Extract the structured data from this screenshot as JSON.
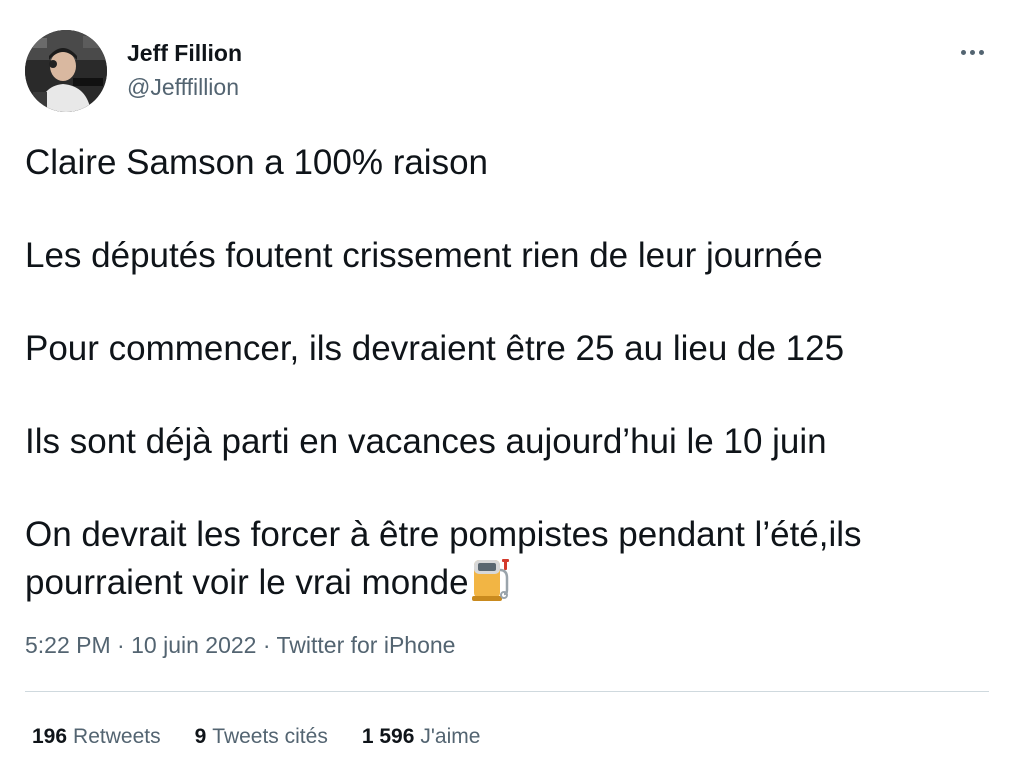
{
  "author": {
    "display_name": "Jeff Fillion",
    "handle": "@Jefffillion",
    "avatar_icon": "profile-photo"
  },
  "more_icon": "more-horizontal-icon",
  "tweet": {
    "paragraphs": [
      "Claire Samson a 100% raison",
      "Les députés foutent crissement rien de leur journée",
      "Pour commencer, ils devraient être 25 au lieu de 125",
      "Ils sont déjà parti en vacances aujourd’hui le 10 juin",
      "On devrait les forcer à être pompistes pendant l’été,ils pourraient voir le vrai monde"
    ],
    "emoji": "fuel-pump"
  },
  "meta": {
    "time": "5:22 PM",
    "separator": "·",
    "date": "10 juin 2022",
    "source": "Twitter for iPhone"
  },
  "stats": {
    "retweets_count": "196",
    "retweets_label": "Retweets",
    "quotes_count": "9",
    "quotes_label": "Tweets cités",
    "likes_count": "1 596",
    "likes_label": "J'aime"
  },
  "colors": {
    "text_primary": "#0f1419",
    "text_secondary": "#536471",
    "divider": "#cfd9de",
    "background": "#ffffff"
  }
}
